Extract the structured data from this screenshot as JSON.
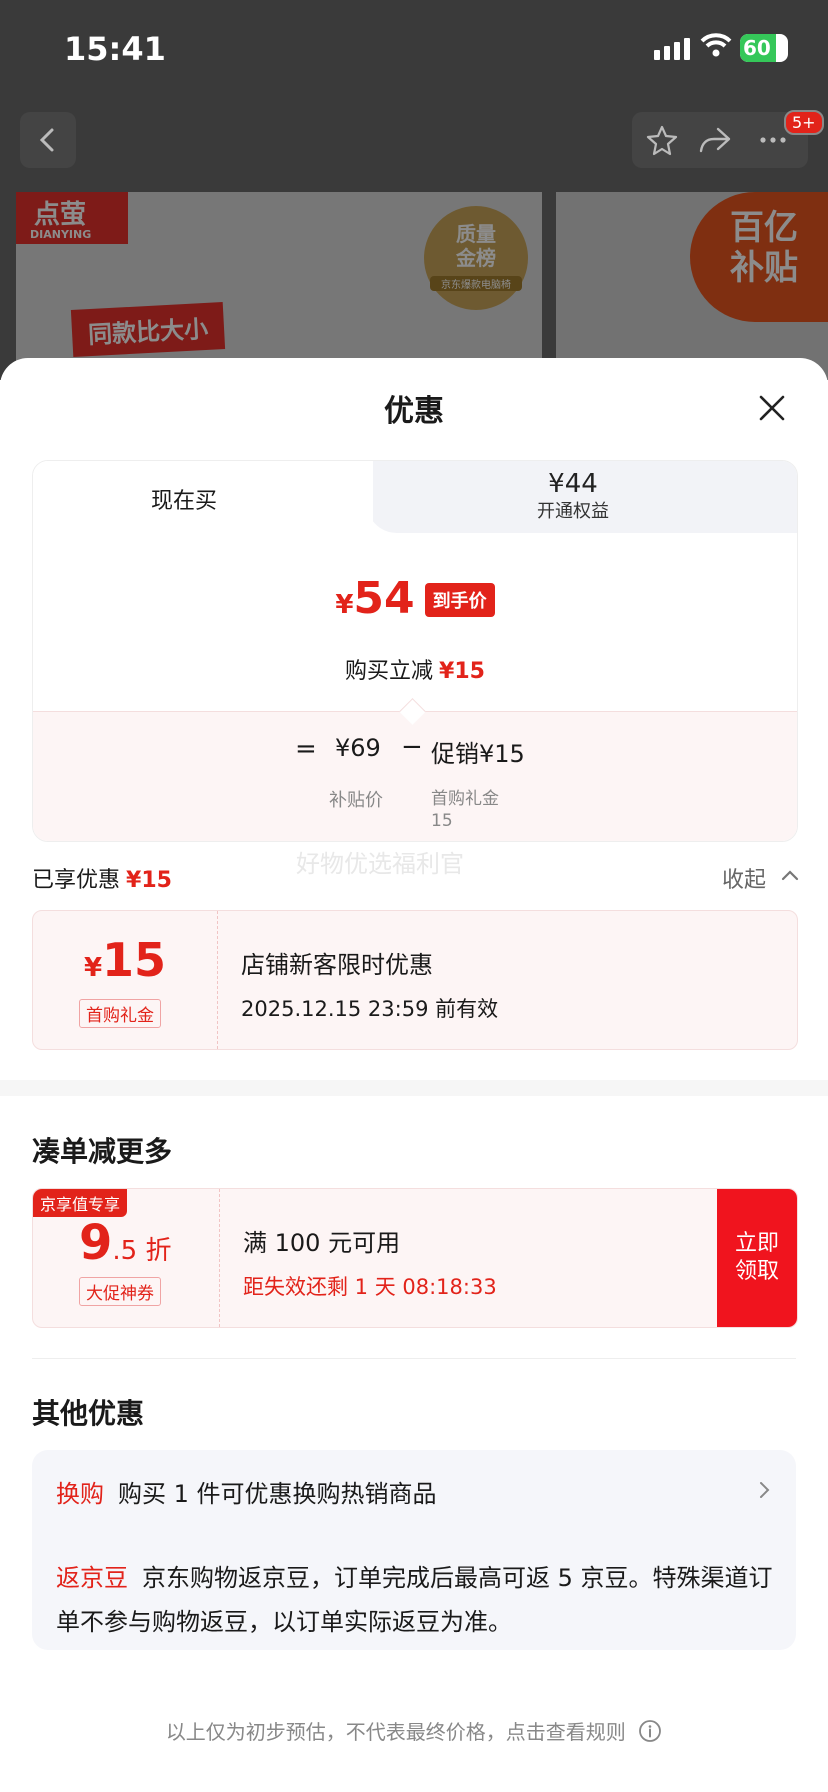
{
  "status_bar": {
    "time": "15:41",
    "battery": "60"
  },
  "nav": {
    "cart_badge": "5+"
  },
  "banner": {
    "brand": "点萤",
    "brand_en": "DIANYING",
    "promo_text": "同款比大小",
    "seal_text": "质量\n金榜",
    "seal_sub": "京东爆款电脑椅",
    "subsidy_text": "百亿\n补贴"
  },
  "sheet": {
    "title": "优惠",
    "tabs": {
      "active_label": "现在买",
      "alt_price": "¥44",
      "alt_label": "开通权益"
    },
    "final_price": {
      "currency": "¥",
      "amount": "54",
      "tag": "到手价"
    },
    "reduce": {
      "label": "购买立减",
      "amount": "¥15"
    },
    "formula": {
      "eq": "=",
      "base": "¥69",
      "minus": "−",
      "promo": "促销¥15",
      "base_label": "补贴价",
      "promo_label_1": "首购礼金",
      "promo_label_2": "15"
    },
    "watermark": "好物优选福利官",
    "enjoyed": {
      "label": "已享优惠",
      "amount": "¥15",
      "collapse": "收起"
    },
    "coupon_applied": {
      "currency": "¥",
      "amount": "15",
      "type_label": "首购礼金",
      "name": "店铺新客限时优惠",
      "validity": "2025.12.15 23:59 前有效"
    },
    "more_section_title": "凑单减更多",
    "coupon_offer": {
      "tag": "京享值专享",
      "discount_big": "9",
      "discount_small": ".5 折",
      "type_label": "大促神券",
      "condition": "满 100 元可用",
      "countdown": "距失效还剩 1 天 08:18:33",
      "button_line1": "立即",
      "button_line2": "领取"
    },
    "other_section_title": "其他优惠",
    "other": {
      "exchange_label": "换购",
      "exchange_text": "购买 1 件可优惠换购热销商品",
      "bean_label": "返京豆",
      "bean_text": "京东购物返京豆，订单完成后最高可返 5 京豆。特殊渠道订单不参与购物返豆，以订单实际返豆为准。"
    },
    "footer": "以上仅为初步预估，不代表最终价格，点击查看规则"
  }
}
